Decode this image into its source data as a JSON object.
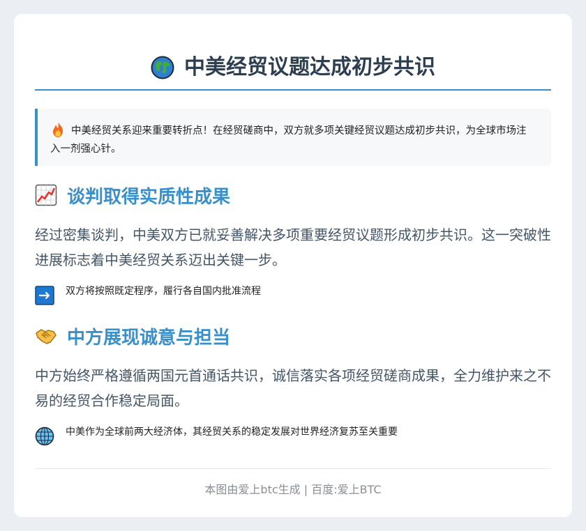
{
  "title": {
    "icon": "globe-icon",
    "text": "中美经贸议题达成初步共识"
  },
  "callout": {
    "icon": "fire-icon",
    "text": "中美经贸关系迎来重要转折点！在经贸磋商中，双方就多项关键经贸议题达成初步共识，为全球市场注入一剂强心针。"
  },
  "sections": [
    {
      "icon": "chart-increasing-icon",
      "heading": "谈判取得实质性成果",
      "paragraph": "经过密集谈判，中美双方已就妥善解决多项重要经贸议题形成初步共识。这一突破性进展标志着中美经贸关系迈出关键一步。",
      "note_icon": "right-arrow-icon",
      "note": "双方将按照既定程序，履行各自国内批准流程"
    },
    {
      "icon": "handshake-icon",
      "heading": "中方展现诚意与担当",
      "paragraph": "中方始终严格遵循两国元首通话共识，诚信落实各项经贸磋商成果，全力维护来之不易的经贸合作稳定局面。",
      "note_icon": "globe-meridians-icon",
      "note": "中美作为全球前两大经济体，其经贸关系的稳定发展对世界经济复苏至关重要"
    }
  ],
  "footer": {
    "text": "本图由爱上btc生成 | 百度:爱上BTC"
  },
  "colors": {
    "accent": "#3a8fc9",
    "title": "#2c3e50",
    "body_text": "#445566",
    "background": "#ebeef2",
    "card": "#ffffff"
  }
}
